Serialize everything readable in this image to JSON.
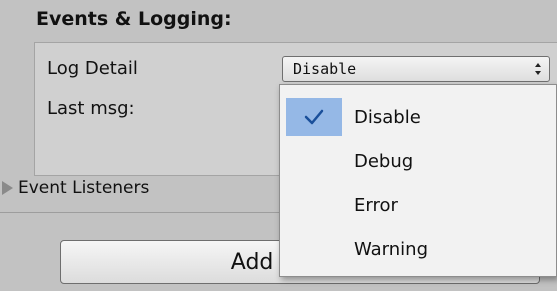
{
  "section": {
    "title": "Events & Logging:"
  },
  "fields": {
    "log_detail_label": "Log Detail",
    "last_msg_label": "Last msg:"
  },
  "log_detail_popup": {
    "selected_value": "Disable",
    "options": [
      {
        "label": "Disable",
        "selected": true
      },
      {
        "label": "Debug",
        "selected": false
      },
      {
        "label": "Error",
        "selected": false
      },
      {
        "label": "Warning",
        "selected": false
      }
    ]
  },
  "foldout": {
    "label": "Event Listeners",
    "expanded": false
  },
  "add_component_button": {
    "visible_text": "Add Co"
  },
  "colors": {
    "background": "#c2c2c2",
    "selection_highlight": "#95b8e6",
    "check_mark": "#1a4f9a"
  },
  "icons": {
    "popup_arrows": "updown-arrows-icon",
    "check": "checkmark-icon",
    "foldout": "triangle-right-icon"
  }
}
